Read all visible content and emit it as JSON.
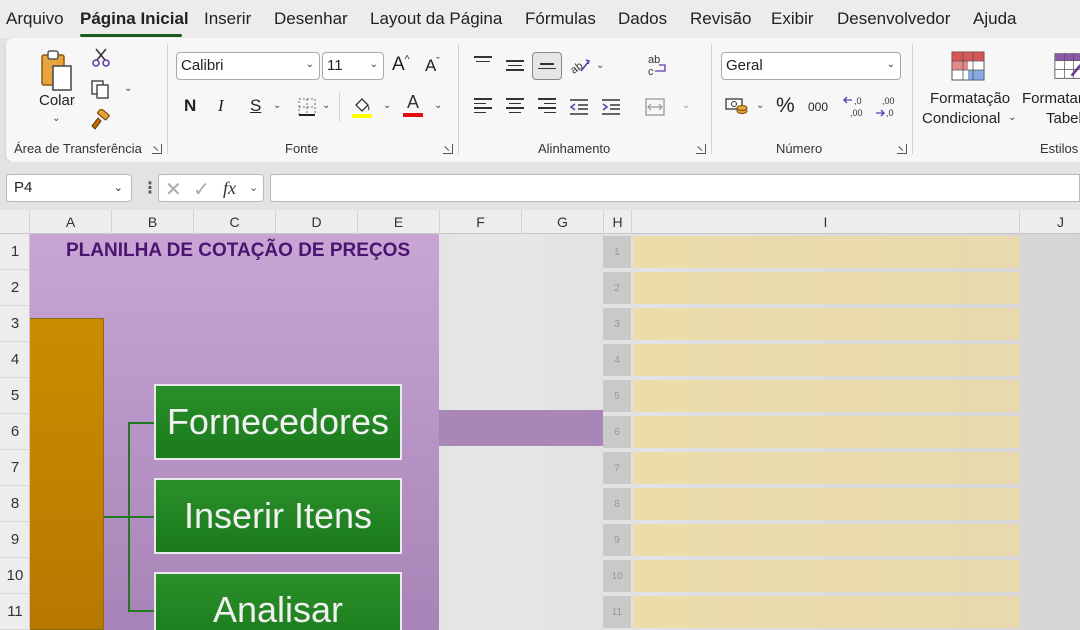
{
  "menu": {
    "items": [
      "Arquivo",
      "Página Inicial",
      "Inserir",
      "Desenhar",
      "Layout da Página",
      "Fórmulas",
      "Dados",
      "Revisão",
      "Exibir",
      "Desenvolvedor",
      "Ajuda"
    ],
    "active": "Página Inicial"
  },
  "ribbon": {
    "clipboard": {
      "paste_label": "Colar",
      "group_label": "Área de Transferência",
      "icons": [
        "paste-icon",
        "cut-icon",
        "copy-icon",
        "format-painter-icon"
      ]
    },
    "font": {
      "font_name": "Calibri",
      "font_size": "11",
      "bold": "N",
      "italic": "I",
      "underline": "S",
      "grow": "A",
      "shrink": "A",
      "font_color_letter": "A",
      "group_label": "Fonte",
      "fill_color": "#ffff00",
      "font_color": "#e01010"
    },
    "alignment": {
      "group_label": "Alinhamento",
      "wrap_label": "ab c"
    },
    "number": {
      "format": "Geral",
      "percent": "%",
      "thousands": "000",
      "increase_decimal": "←,0 ,00",
      "decrease_decimal": ",00 →,0",
      "group_label": "Número"
    },
    "styles": {
      "conditional_line1": "Formatação",
      "conditional_line2": "Condicional",
      "table_line1": "Formatar",
      "table_line2": "Tabela",
      "group_label": "Estilos"
    }
  },
  "formula_bar": {
    "cell_ref": "P4",
    "fx": "fx",
    "formula": ""
  },
  "columns": [
    "A",
    "B",
    "C",
    "D",
    "E",
    "F",
    "G",
    "H",
    "I",
    "J"
  ],
  "rows": [
    "1",
    "2",
    "3",
    "4",
    "5",
    "6",
    "7",
    "8",
    "9",
    "10",
    "11"
  ],
  "sheet": {
    "title": "PLANILHA DE COTAÇÃO DE PREÇOS",
    "buttons": [
      "Fornecedores",
      "Inserir Itens",
      "Analisar"
    ],
    "row_numbers": [
      "1",
      "2",
      "3",
      "4",
      "5",
      "6",
      "7",
      "8",
      "9",
      "10",
      "11"
    ],
    "colors": {
      "purple_panel": "#b996c8",
      "title": "#4b1470",
      "orange_bar": "#c28300",
      "button_green": "#1f861f",
      "tan": "#eadaab"
    }
  }
}
